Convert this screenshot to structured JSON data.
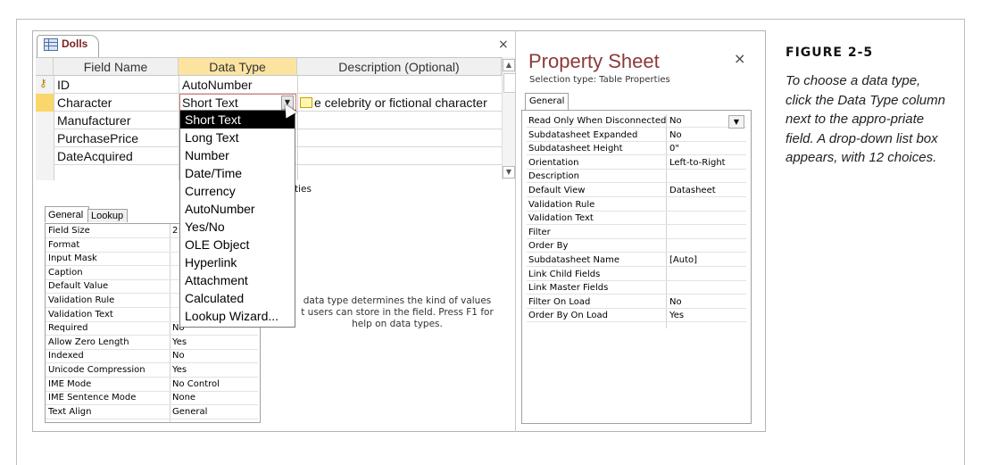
{
  "table_tab": {
    "label": "Dolls",
    "close": "×"
  },
  "grid": {
    "headers": [
      "Field Name",
      "Data Type",
      "Description (Optional)"
    ],
    "rows": [
      {
        "name": "ID",
        "type": "AutoNumber",
        "desc": ""
      },
      {
        "name": "Character",
        "type": "Short Text",
        "desc": "e celebrity or fictional character"
      },
      {
        "name": "Manufacturer",
        "type": "",
        "desc": ""
      },
      {
        "name": "PurchasePrice",
        "type": "",
        "desc": ""
      },
      {
        "name": "DateAcquired",
        "type": "",
        "desc": ""
      }
    ],
    "partial_text": "ties"
  },
  "dropdown": {
    "options": [
      "Short Text",
      "Long Text",
      "Number",
      "Date/Time",
      "Currency",
      "AutoNumber",
      "Yes/No",
      "OLE Object",
      "Hyperlink",
      "Attachment",
      "Calculated",
      "Lookup Wizard..."
    ],
    "highlighted": "Short Text"
  },
  "field_props": {
    "tabs": [
      "General",
      "Lookup"
    ],
    "rows": [
      {
        "k": "Field Size",
        "v": "2!"
      },
      {
        "k": "Format",
        "v": ""
      },
      {
        "k": "Input Mask",
        "v": ""
      },
      {
        "k": "Caption",
        "v": ""
      },
      {
        "k": "Default Value",
        "v": ""
      },
      {
        "k": "Validation Rule",
        "v": ""
      },
      {
        "k": "Validation Text",
        "v": ""
      },
      {
        "k": "Required",
        "v": "No"
      },
      {
        "k": "Allow Zero Length",
        "v": "Yes"
      },
      {
        "k": "Indexed",
        "v": "No"
      },
      {
        "k": "Unicode Compression",
        "v": "Yes"
      },
      {
        "k": "IME Mode",
        "v": "No Control"
      },
      {
        "k": "IME Sentence Mode",
        "v": "None"
      },
      {
        "k": "Text Align",
        "v": "General"
      }
    ]
  },
  "hint": {
    "line1": "data type determines the kind of values",
    "line2": "t users can store in the field. Press F1 for",
    "line3": "help on data types."
  },
  "property_sheet": {
    "title": "Property Sheet",
    "close": "×",
    "selection_type": "Selection type:  Table Properties",
    "tab": "General",
    "rows": [
      {
        "k": "Read Only When Disconnected",
        "v": "No"
      },
      {
        "k": "Subdatasheet Expanded",
        "v": "No"
      },
      {
        "k": "Subdatasheet Height",
        "v": "0\""
      },
      {
        "k": "Orientation",
        "v": "Left-to-Right"
      },
      {
        "k": "Description",
        "v": ""
      },
      {
        "k": "Default View",
        "v": "Datasheet"
      },
      {
        "k": "Validation Rule",
        "v": ""
      },
      {
        "k": "Validation Text",
        "v": ""
      },
      {
        "k": "Filter",
        "v": ""
      },
      {
        "k": "Order By",
        "v": ""
      },
      {
        "k": "Subdatasheet Name",
        "v": "[Auto]"
      },
      {
        "k": "Link Child Fields",
        "v": ""
      },
      {
        "k": "Link Master Fields",
        "v": ""
      },
      {
        "k": "Filter On Load",
        "v": "No"
      },
      {
        "k": "Order By On Load",
        "v": "Yes"
      }
    ]
  },
  "caption": {
    "title": "FIGURE 2-5",
    "body": "To choose a data type, click the Data Type column next to the appro-priate field. A drop-down list box appears, with 12 choices."
  },
  "colors": {
    "accent": "#8b3a3a",
    "selected_cell": "#fde6a0",
    "highlight": "#000000"
  }
}
